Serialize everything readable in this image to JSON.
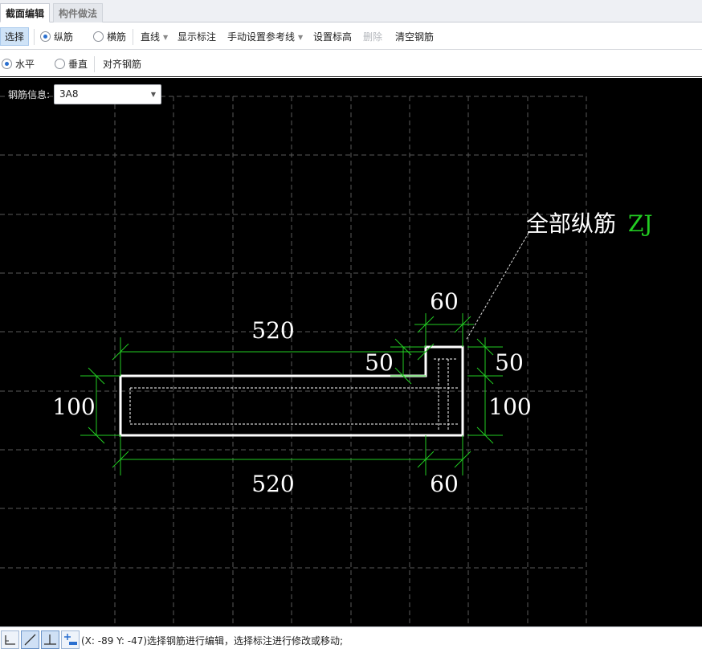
{
  "tabs": [
    {
      "label": "截面编辑",
      "active": true
    },
    {
      "label": "构件做法",
      "active": false
    }
  ],
  "toolbar1": {
    "select": "选择",
    "longitudinal": "纵筋",
    "transverse": "横筋",
    "line": "直线",
    "show_annotation": "显示标注",
    "manual_ref_line": "手动设置参考线",
    "set_elevation": "设置标高",
    "delete": "删除",
    "clear_rebar": "清空钢筋"
  },
  "toolbar2": {
    "horizontal": "水平",
    "vertical": "垂直",
    "align_rebar": "对齐钢筋"
  },
  "rebar_info": {
    "label": "钢筋信息:",
    "value": "3A8"
  },
  "drawing": {
    "annotation_text": "全部纵筋",
    "annotation_code": "ZJ",
    "dims": {
      "top_length": "520",
      "top_notch_width": "60",
      "notch_depth_left": "50",
      "notch_depth_right": "50",
      "left_height": "100",
      "right_height": "100",
      "bottom_length": "520",
      "bottom_notch_width": "60"
    },
    "colors": {
      "background": "#000000",
      "grid": "#5a5a5a",
      "outline": "#ffffff",
      "dimension_lines": "#22cc22",
      "text": "#ffffff",
      "code_text": "#22cc22"
    }
  },
  "status": {
    "text": "(X: -89 Y: -47)选择钢筋进行编辑，选择标注进行修改或移动;"
  },
  "icons": [
    "orthogonal-icon",
    "line-icon",
    "perpendicular-icon",
    "add-point-icon"
  ]
}
